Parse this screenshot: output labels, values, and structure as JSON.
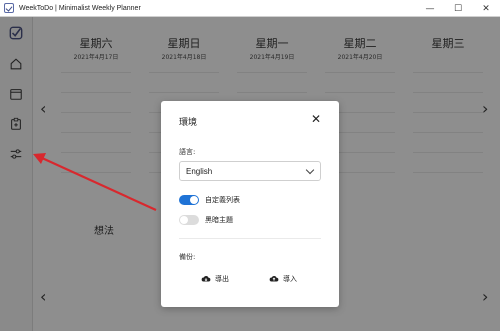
{
  "window": {
    "title": "WeekToDo | Minimalist Weekly Planner",
    "minimize": "—",
    "maximize": "☐",
    "close": "✕"
  },
  "sidebar": {
    "items": [
      {
        "icon": "logo-icon"
      },
      {
        "icon": "home-icon"
      },
      {
        "icon": "calendar-icon"
      },
      {
        "icon": "clipboard-icon"
      },
      {
        "icon": "settings-sliders-icon"
      }
    ]
  },
  "days": [
    {
      "name": "星期六",
      "date": "2021年4月17日"
    },
    {
      "name": "星期日",
      "date": "2021年4月18日"
    },
    {
      "name": "星期一",
      "date": "2021年4月19日"
    },
    {
      "name": "星期二",
      "date": "2021年4月20日"
    },
    {
      "name": "星期三"
    }
  ],
  "nav": {
    "prev": "‹",
    "next": "›"
  },
  "thoughts_label": "想法",
  "settings_modal": {
    "title": "環境",
    "close": "✕",
    "language_label": "語言:",
    "language_value": "English",
    "toggles": [
      {
        "label": "自定義列表",
        "on": true
      },
      {
        "label": "黑暗主題",
        "on": false
      }
    ],
    "backup_label": "備份:",
    "export_label": "導出",
    "import_label": "導入"
  },
  "colors": {
    "accent": "#1f73d6",
    "overlay": "#8e8e8e",
    "modal_bg": "#ffffff"
  }
}
